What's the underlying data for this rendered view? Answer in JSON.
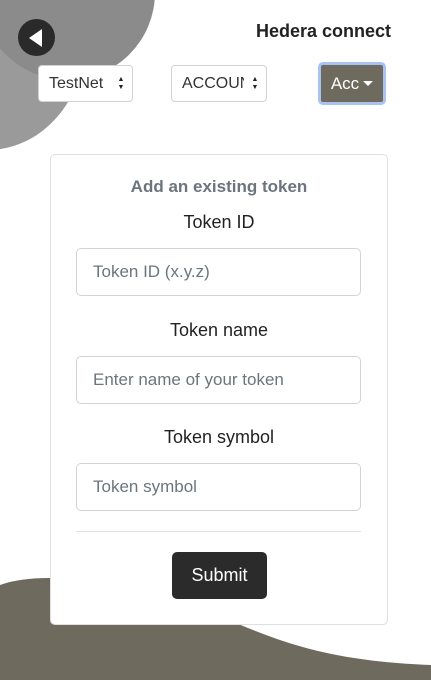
{
  "header": {
    "title": "Hedera connect",
    "back_icon": "back-arrow-icon"
  },
  "selectors": {
    "network": {
      "value": "TestNet"
    },
    "account": {
      "value": "ACCOUNT"
    },
    "account_menu": {
      "label": "Acc"
    }
  },
  "form": {
    "title": "Add an existing token",
    "token_id": {
      "label": "Token ID",
      "placeholder": "Token ID (x.y.z)"
    },
    "token_name": {
      "label": "Token name",
      "placeholder": "Enter name of your token"
    },
    "token_symbol": {
      "label": "Token symbol",
      "placeholder": "Token symbol"
    },
    "submit_label": "Submit"
  },
  "colors": {
    "accent": "#6f6a5e",
    "button_dark": "#2b2b2b",
    "focus_ring": "#a9c3ec",
    "blob_gray": "#9a9a9a"
  }
}
